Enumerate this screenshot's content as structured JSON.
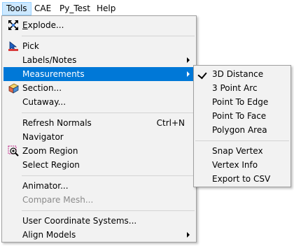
{
  "menubar": {
    "items": [
      "Tools",
      "CAE",
      "Py_Test",
      "Help"
    ]
  },
  "tools_menu": {
    "explode": "xplode...",
    "explode_mnemonic": "E",
    "pick": "Pick",
    "labels_notes": "Labels/Notes",
    "measurements": "Measurements",
    "section": "Section...",
    "cutaway": "Cutaway...",
    "refresh_normals": "Refresh Normals",
    "refresh_normals_shortcut": "Ctrl+N",
    "navigator": "Navigator",
    "zoom_region": "Zoom Region",
    "select_region": "Select Region",
    "animator": "Animator...",
    "compare_mesh": "Compare Mesh...",
    "user_coordinate_systems": "User Coordinate Systems...",
    "align_models": "Align Models"
  },
  "measurements_submenu": {
    "items": [
      "3D Distance",
      "3 Point Arc",
      "Point To Edge",
      "Point To Face",
      "Polygon Area",
      "Snap Vertex",
      "Vertex Info",
      "Export to CSV"
    ],
    "checked_item": "3D Distance"
  },
  "colors": {
    "highlight": "#0078d7",
    "menu_background": "#f2f2f2",
    "menubar_active": "#cce8ff",
    "disabled_text": "#8a8a8a"
  }
}
